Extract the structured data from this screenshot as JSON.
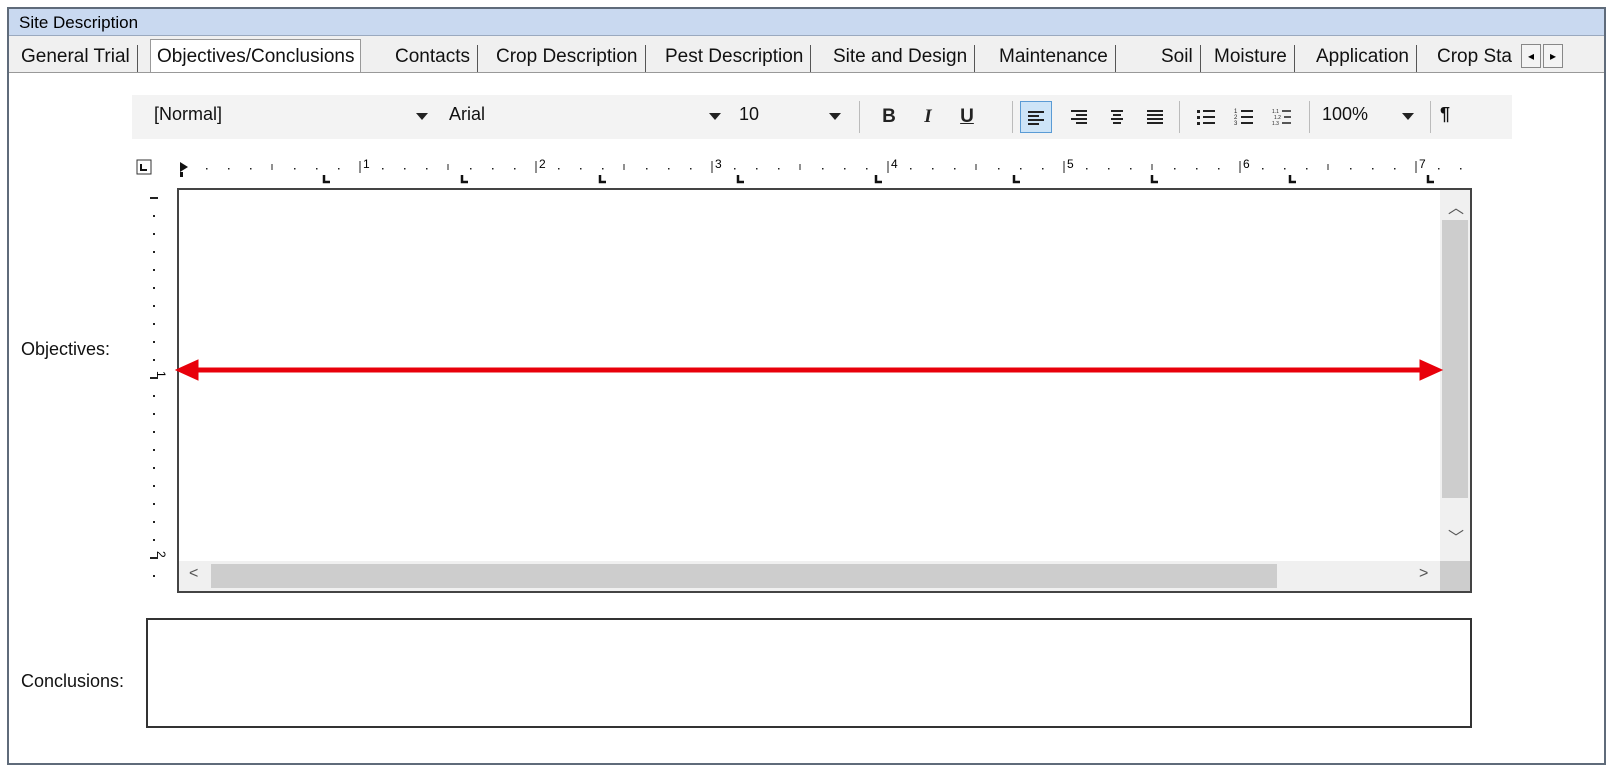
{
  "window": {
    "title": "Site Description"
  },
  "tabs": [
    {
      "label": "General Trial"
    },
    {
      "label": "Objectives/Conclusions",
      "active": true
    },
    {
      "label": "Contacts"
    },
    {
      "label": "Crop Description"
    },
    {
      "label": "Pest Description"
    },
    {
      "label": "Site and Design"
    },
    {
      "label": "Maintenance"
    },
    {
      "label": "Soil"
    },
    {
      "label": "Moisture"
    },
    {
      "label": "Application"
    },
    {
      "label": "Crop Sta"
    }
  ],
  "toolbar": {
    "style": "[Normal]",
    "font": "Arial",
    "size": "10",
    "bold": "B",
    "italic": "I",
    "underline": "U",
    "zoom": "100%",
    "pilcrow": "¶"
  },
  "ruler": {
    "h_numbers": [
      "1",
      "2",
      "3",
      "4",
      "5",
      "6",
      "7"
    ],
    "v_numbers": [
      "1",
      "2"
    ]
  },
  "fields": {
    "objectives_label": "Objectives:",
    "conclusions_label": "Conclusions:"
  },
  "annotation": {
    "arrow_color": "#e8000b"
  }
}
